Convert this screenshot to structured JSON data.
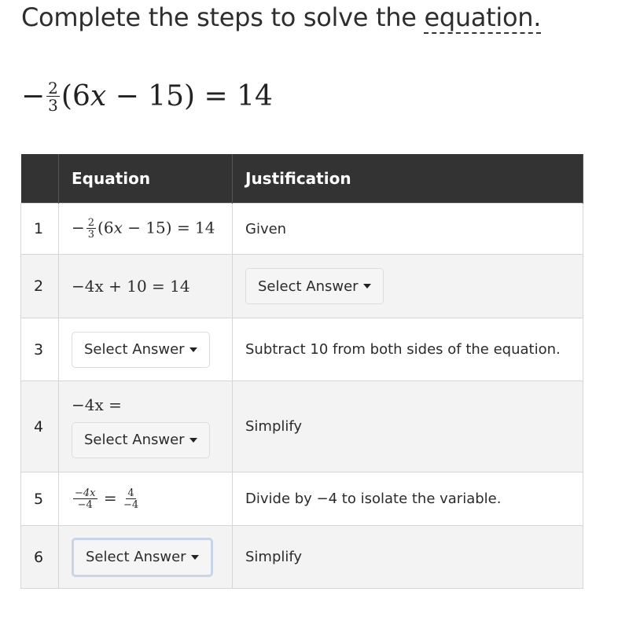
{
  "instruction": {
    "prefix": "Complete the steps to solve the ",
    "link": "equation."
  },
  "main_equation": {
    "minus": "−",
    "frac_num": "2",
    "frac_den": "3",
    "paren_open": "(6",
    "var": "x",
    "rest": " − 15) = 14"
  },
  "table": {
    "headers": [
      "",
      "Equation",
      "Justification"
    ],
    "rows": [
      {
        "n": "1",
        "justification": "Given"
      },
      {
        "n": "2",
        "equation": "−4x + 10 = 14",
        "justification_select": "Select Answer"
      },
      {
        "n": "3",
        "equation_select": "Select Answer",
        "justification": "Subtract 10 from both sides of the equation."
      },
      {
        "n": "4",
        "equation_prefix": "−4x =",
        "equation_select": "Select Answer",
        "justification": "Simplify"
      },
      {
        "n": "5",
        "justification": "Divide by −4 to isolate the variable."
      },
      {
        "n": "6",
        "equation_select": "Select Answer",
        "justification": "Simplify"
      }
    ]
  },
  "row1_eq": {
    "minus": "−",
    "num": "2",
    "den": "3",
    "rest_a": "(6",
    "var": "x",
    "rest_b": " − 15) = 14"
  },
  "row5_eq": {
    "l_num": "−4x",
    "l_den": "−4",
    "eq": "=",
    "r_num": "4",
    "r_den": "−4"
  }
}
